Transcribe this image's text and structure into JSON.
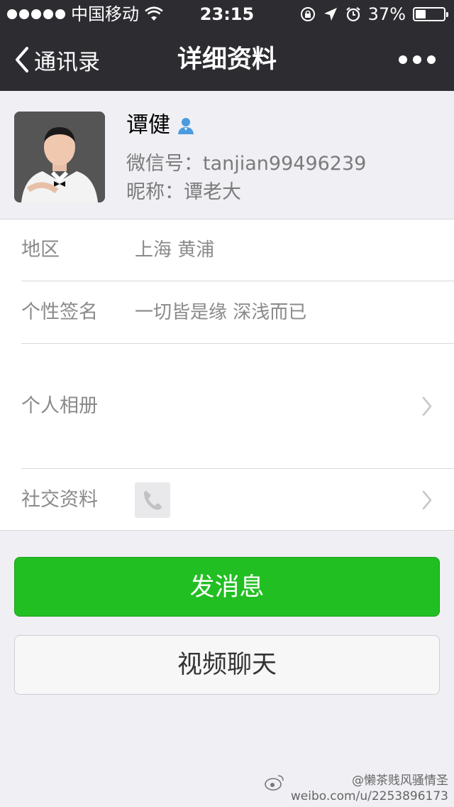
{
  "status_bar": {
    "carrier": "中国移动",
    "time": "23:15",
    "battery_text": "37%",
    "battery_level": 0.37,
    "icons": [
      "signal-dots-icon",
      "wifi-icon",
      "rotation-lock-icon",
      "location-arrow-icon",
      "alarm-clock-icon",
      "battery-icon"
    ]
  },
  "nav": {
    "back_label": "通讯录",
    "title": "详细资料",
    "more_icon": "more-dots-icon"
  },
  "profile": {
    "name": "谭健",
    "wechat_id": "微信号：tanjian99496239",
    "nickname": "昵称：谭老大",
    "badge_icon": "person-icon"
  },
  "rows": [
    {
      "label": "地区",
      "value": "上海 黄浦"
    },
    {
      "label": "个性签名",
      "value": "一切皆是缘 深浅而已"
    },
    {
      "label": "个人相册",
      "value": ""
    },
    {
      "label": "社交资料",
      "value": "",
      "icon": "phone-icon"
    }
  ],
  "buttons": {
    "send_message": "发消息",
    "video_chat": "视频聊天"
  },
  "watermark": {
    "line1": "@懒茶贱风骚情圣",
    "line2": "weibo.com/u/2253896173",
    "icon": "weibo-logo-icon"
  },
  "colors": {
    "nav_bg": "#2d2c31",
    "accent_green": "#22bf22",
    "page_bg": "#efeff4"
  }
}
